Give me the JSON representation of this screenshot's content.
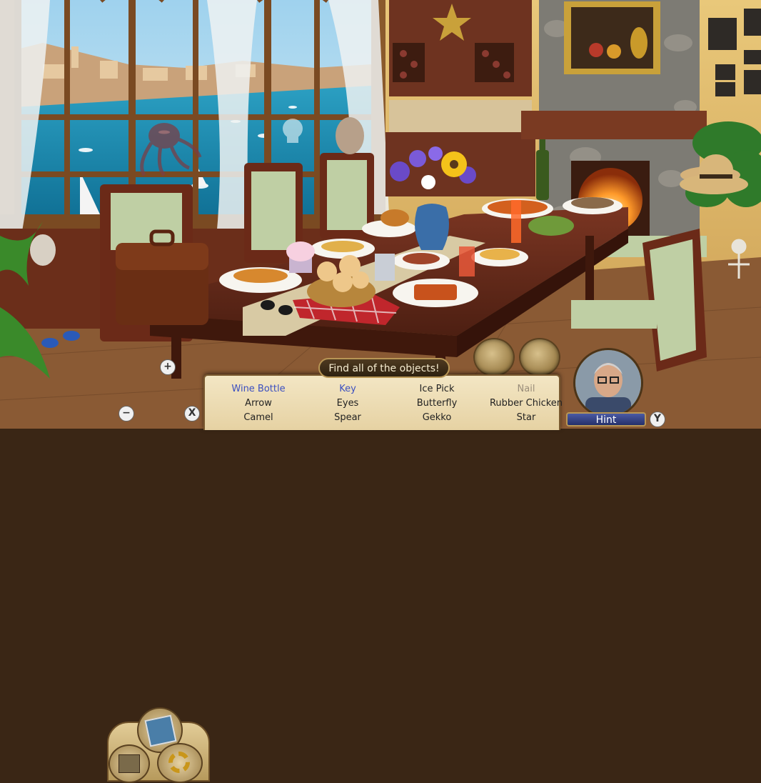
{
  "hud": {
    "title": "Find all of the objects!",
    "hint_label": "Hint",
    "hint_key": "Y",
    "close_key": "X",
    "zoom_in": "+",
    "zoom_out": "−"
  },
  "items": [
    {
      "label": "Wine Bottle",
      "state": "found"
    },
    {
      "label": "Key",
      "state": "found"
    },
    {
      "label": "Ice Pick",
      "state": "pending"
    },
    {
      "label": "Nail",
      "state": "dim"
    },
    {
      "label": "Arrow",
      "state": "pending"
    },
    {
      "label": "Eyes",
      "state": "pending"
    },
    {
      "label": "Butterfly",
      "state": "pending"
    },
    {
      "label": "Rubber Chicken",
      "state": "pending"
    },
    {
      "label": "Camel",
      "state": "pending"
    },
    {
      "label": "Spear",
      "state": "pending"
    },
    {
      "label": "Gekko",
      "state": "pending"
    },
    {
      "label": "Star",
      "state": "pending"
    }
  ],
  "colors": {
    "found": "#3b4fc0",
    "pending": "#222222",
    "dim": "#9a8d7a",
    "sea": "#2aa0c4",
    "wood": "#5a2d1a",
    "tablecloth": "#c8b895"
  }
}
